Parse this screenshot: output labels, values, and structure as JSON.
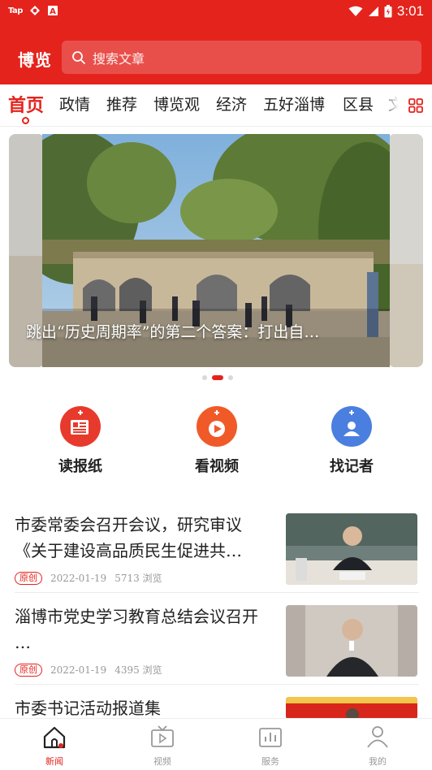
{
  "status_bar": {
    "carrier": "Tap",
    "time": "3:01"
  },
  "header": {
    "logo_text": "博览",
    "search_placeholder": "搜索文章"
  },
  "tabs": [
    {
      "label": "首页",
      "active": true
    },
    {
      "label": "政情"
    },
    {
      "label": "推荐"
    },
    {
      "label": "博览观"
    },
    {
      "label": "经济"
    },
    {
      "label": "五好淄博"
    },
    {
      "label": "区县"
    },
    {
      "label": "文"
    }
  ],
  "banner": {
    "caption": "跳出“历史周期率”的第二个答案：打出自…",
    "slide_count": 3,
    "active_slide": 2
  },
  "quick_actions": [
    {
      "label": "读报纸",
      "icon": "newspaper-icon"
    },
    {
      "label": "看视频",
      "icon": "video-play-icon"
    },
    {
      "label": "找记者",
      "icon": "reporter-icon"
    }
  ],
  "news": [
    {
      "title": "市委常委会召开会议，研究审议《关于建设高品质民生促进共…",
      "badge": "原创",
      "date": "2022-01-19",
      "views": "5713 浏览"
    },
    {
      "title": "淄博市党史学习教育总结会议召开 …",
      "badge": "原创",
      "date": "2022-01-19",
      "views": "4395 浏览"
    },
    {
      "title": "市委书记活动报道集"
    }
  ],
  "bottom_nav": [
    {
      "label": "新闻",
      "icon": "home-icon",
      "active": true
    },
    {
      "label": "视频",
      "icon": "tv-icon"
    },
    {
      "label": "服务",
      "icon": "chart-icon"
    },
    {
      "label": "我的",
      "icon": "user-icon"
    }
  ],
  "colors": {
    "brand_red": "#e4231d",
    "quick_red": "#e83a2c",
    "quick_orange": "#f05a28",
    "quick_blue": "#4a7fe0"
  }
}
